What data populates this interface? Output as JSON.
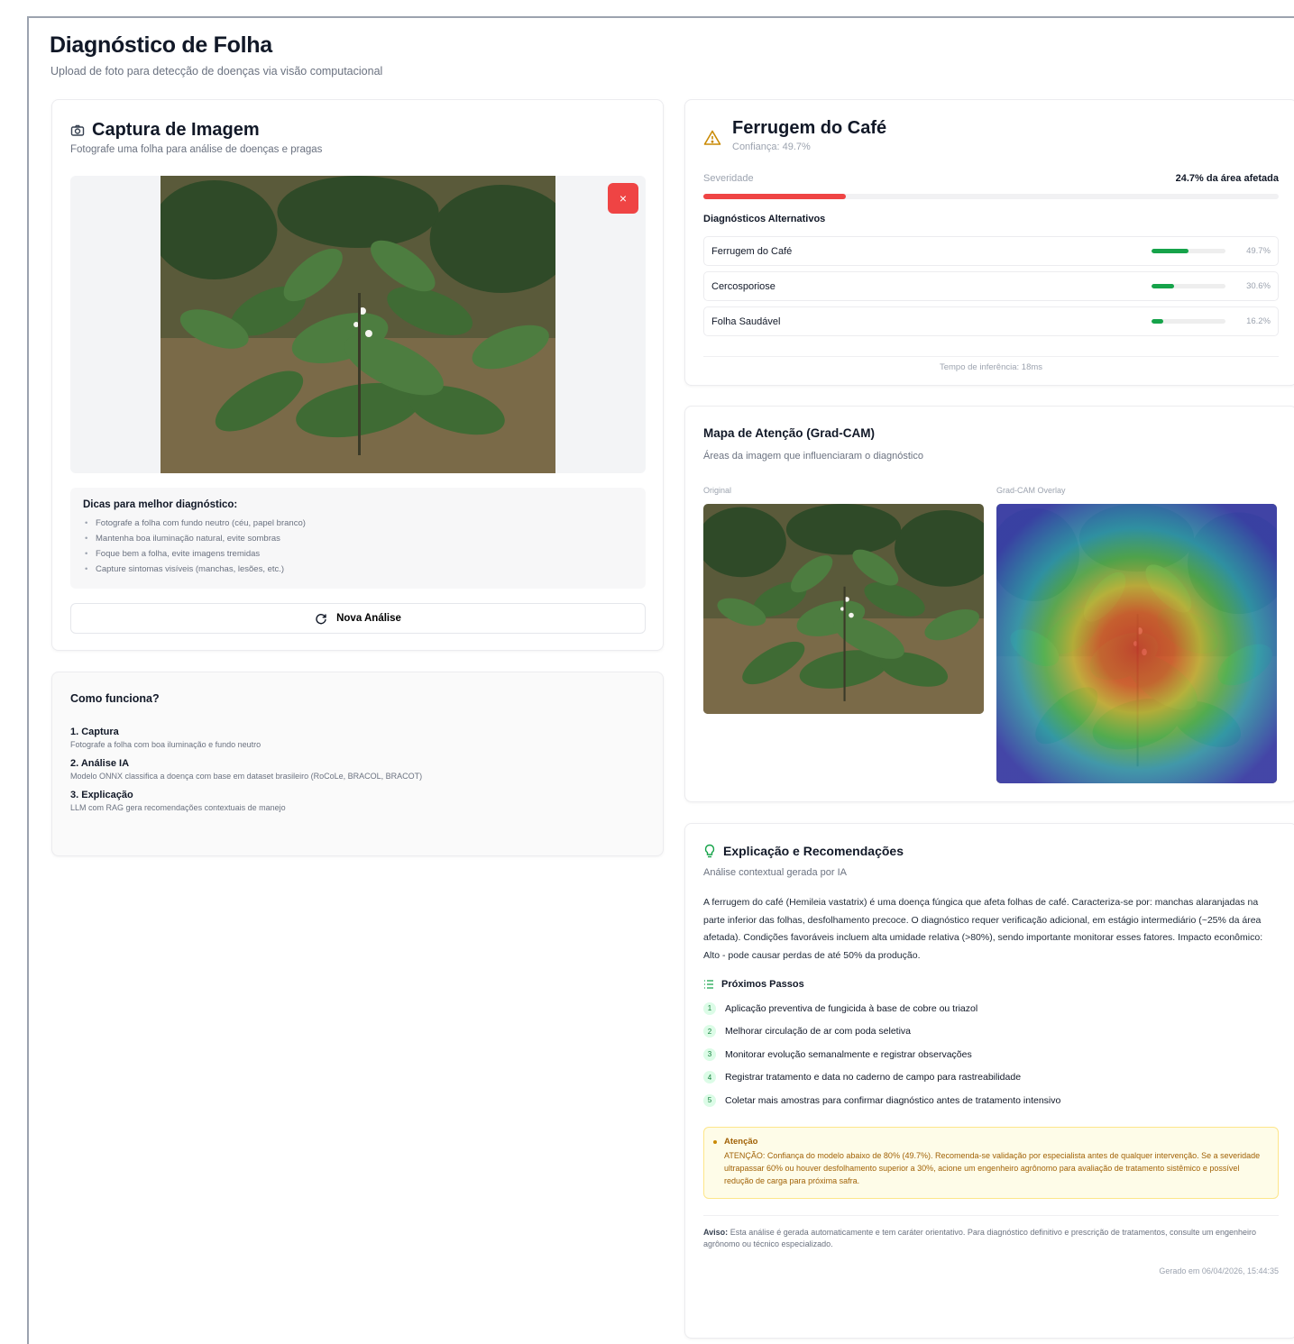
{
  "header": {
    "title": "Diagnóstico de Folha",
    "subtitle": "Upload de foto para detecção de doenças via visão computacional"
  },
  "capture": {
    "title": "Captura de Imagem",
    "subtitle": "Fotografe uma folha para análise de doenças e pragas",
    "remove_label": "×",
    "tips_title": "Dicas para melhor diagnóstico:",
    "tips": [
      "Fotografe a folha com fundo neutro (céu, papel branco)",
      "Mantenha boa iluminação natural, evite sombras",
      "Foque bem a folha, evite imagens tremidas",
      "Capture sintomas visíveis (manchas, lesões, etc.)"
    ],
    "new_analysis_label": "Nova Análise"
  },
  "how": {
    "title": "Como funciona?",
    "steps": [
      {
        "title": "1. Captura",
        "desc": "Fotografe a folha com boa iluminação e fundo neutro"
      },
      {
        "title": "2. Análise IA",
        "desc": "Modelo ONNX classifica a doença com base em dataset brasileiro (RoCoLe, BRACOL, BRACOT)"
      },
      {
        "title": "3. Explicação",
        "desc": "LLM com RAG gera recomendações contextuais de manejo"
      }
    ]
  },
  "diagnosis": {
    "title": "Ferrugem do Café",
    "confidence": "Confiança: 49.7%",
    "severity_label": "Severidade",
    "severity_value": "24.7% da área afetada",
    "severity_fraction": 0.247,
    "alternatives_title": "Diagnósticos Alternativos",
    "alternatives": [
      {
        "name": "Ferrugem do Café",
        "pct": "49.7%",
        "fraction": 0.497
      },
      {
        "name": "Cercosporiose",
        "pct": "30.6%",
        "fraction": 0.306
      },
      {
        "name": "Folha Saudável",
        "pct": "16.2%",
        "fraction": 0.162
      }
    ],
    "inference_time": "Tempo de inferência: 18ms"
  },
  "gradcam": {
    "title": "Mapa de Atenção (Grad-CAM)",
    "subtitle": "Áreas da imagem que influenciaram o diagnóstico",
    "original_label": "Original",
    "overlay_label": "Grad-CAM Overlay"
  },
  "explanation": {
    "title": "Explicação e Recomendações",
    "subtitle": "Análise contextual gerada por IA",
    "body": "A ferrugem do café (Hemileia vastatrix) é uma doença fúngica que afeta folhas de café. Caracteriza-se por: manchas alaranjadas na parte inferior das folhas, desfolhamento precoce. O diagnóstico requer verificação adicional, em estágio intermediário (~25% da área afetada). Condições favoráveis incluem alta umidade relativa (>80%), sendo importante monitorar esses fatores. Impacto econômico: Alto - pode causar perdas de até 50% da produção.",
    "steps_title": "Próximos Passos",
    "steps": [
      "Aplicação preventiva de fungicida à base de cobre ou triazol",
      "Melhorar circulação de ar com poda seletiva",
      "Monitorar evolução semanalmente e registrar observações",
      "Registrar tratamento e data no caderno de campo para rastreabilidade",
      "Coletar mais amostras para confirmar diagnóstico antes de tratamento intensivo"
    ],
    "warning_title": "Atenção",
    "warning_text": "ATENÇÃO: Confiança do modelo abaixo de 80% (49.7%). Recomenda-se validação por especialista antes de qualquer intervenção. Se a severidade ultrapassar 60% ou houver desfolhamento superior a 30%, acione um engenheiro agrônomo para avaliação de tratamento sistêmico e possível redução de carga para próxima safra.",
    "notice_label": "Aviso:",
    "notice_text": "Esta análise é gerada automaticamente e tem caráter orientativo. Para diagnóstico definitivo e prescrição de tratamentos, consulte um engenheiro agrônomo ou técnico especializado.",
    "generated_at": "Gerado em 06/04/2026, 15:44:35"
  },
  "colors": {
    "danger": "#ef4444",
    "success": "#16a34a",
    "warning_bg": "#fefce8",
    "warning_text": "#a16207"
  }
}
